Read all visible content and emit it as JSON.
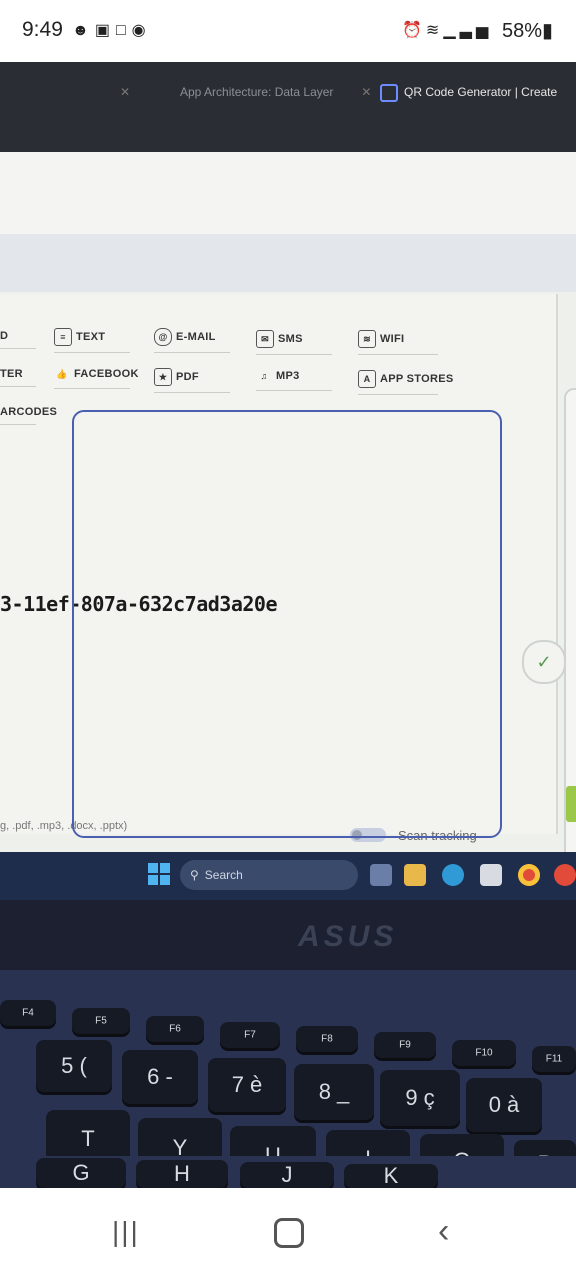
{
  "status_bar": {
    "time": "9:49",
    "battery": "58%",
    "left_icons": [
      "notification-icon",
      "image-icon",
      "screenshot-icon",
      "shazam-icon"
    ],
    "right_icons": [
      "alarm-icon",
      "wifi-icon",
      "signal-icon"
    ]
  },
  "browser": {
    "tabs": [
      {
        "label": "",
        "active": false
      },
      {
        "label": "App Architecture: Data Layer",
        "active": false
      },
      {
        "label": "QR Code Generator | Create",
        "active": true
      }
    ]
  },
  "qr_page": {
    "types_row1": [
      {
        "label": "D",
        "icon": "link-icon"
      },
      {
        "label": "TEXT",
        "icon": "text-icon"
      },
      {
        "label": "E-MAIL",
        "icon": "at-icon"
      },
      {
        "label": "SMS",
        "icon": "sms-icon"
      },
      {
        "label": "WIFI",
        "icon": "wifi-icon"
      }
    ],
    "types_row2": [
      {
        "label": "TER",
        "icon": "twitter-icon"
      },
      {
        "label": "FACEBOOK",
        "icon": "thumbs-up-icon"
      },
      {
        "label": "PDF",
        "icon": "pdf-icon"
      },
      {
        "label": "MP3",
        "icon": "music-note-icon"
      },
      {
        "label": "APP STORES",
        "icon": "app-store-icon"
      }
    ],
    "types_row3": [
      {
        "label": "ARCODES"
      }
    ],
    "uuid_text": "3-11ef-807a-632c7ad3a20e",
    "file_formats": "g, .pdf, .mp3, .docx, .pptx)",
    "scan_tracking_label": "Scan tracking"
  },
  "taskbar": {
    "search_label": "Search"
  },
  "laptop": {
    "brand": "ASUS"
  },
  "keyboard": {
    "fn_row": [
      "F4",
      "F5",
      "F6",
      "F7",
      "F8",
      "F9",
      "F10",
      "F11"
    ],
    "num_row": [
      "5 (",
      "6 -",
      "7 è",
      "8 _",
      "9 ç",
      "0 à"
    ],
    "letter_row": [
      "T",
      "Y",
      "U",
      "I",
      "O",
      "P"
    ],
    "home_row": [
      "G",
      "H",
      "J",
      "K"
    ]
  }
}
